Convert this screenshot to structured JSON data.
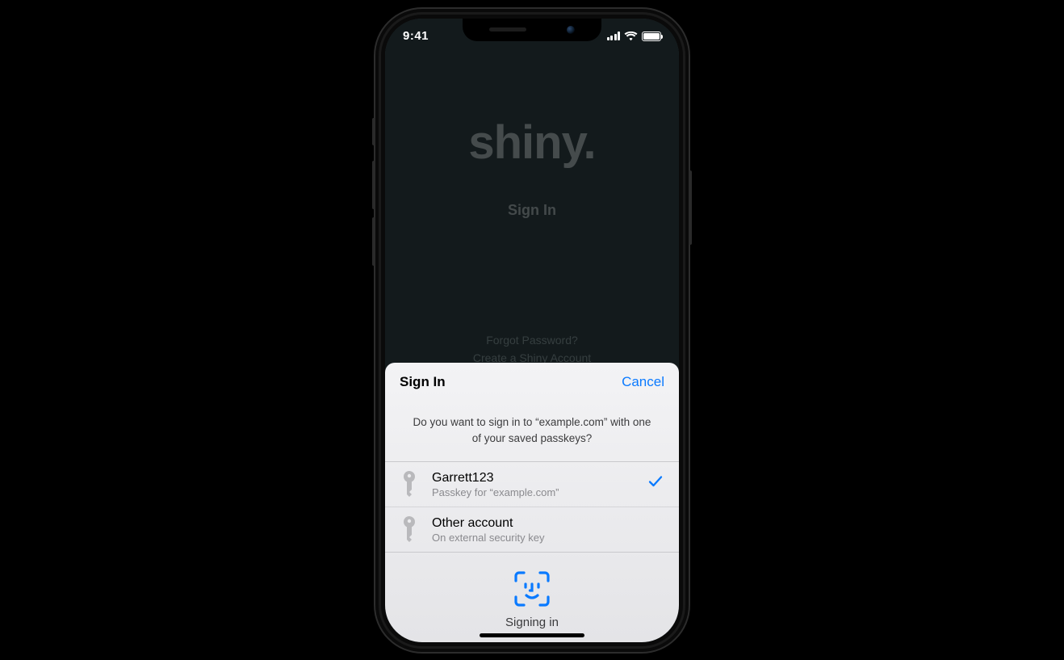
{
  "statusBar": {
    "time": "9:41"
  },
  "app": {
    "logo": "shiny.",
    "signIn": "Sign In",
    "forgot": "Forgot Password?",
    "create": "Create a Shiny Account"
  },
  "sheet": {
    "title": "Sign In",
    "cancel": "Cancel",
    "prompt": "Do you want to sign in to “example.com” with one of your saved passkeys?",
    "accounts": [
      {
        "name": "Garrett123",
        "sub": "Passkey for “example.com”",
        "selected": true
      },
      {
        "name": "Other account",
        "sub": "On external security key",
        "selected": false
      }
    ],
    "action": "Signing in"
  },
  "colors": {
    "accent": "#0a7aff"
  }
}
